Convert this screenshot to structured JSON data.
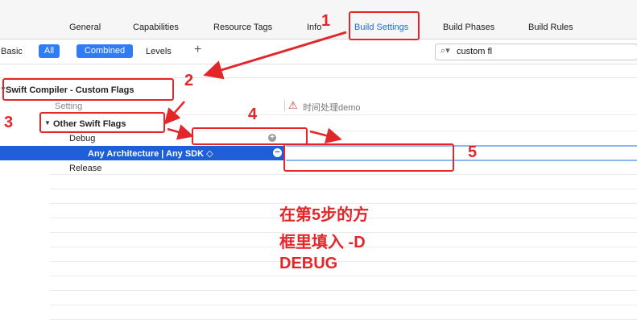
{
  "tabs": [
    {
      "label": "General",
      "active": false
    },
    {
      "label": "Capabilities",
      "active": false
    },
    {
      "label": "Resource Tags",
      "active": false
    },
    {
      "label": "Info",
      "active": false
    },
    {
      "label": "Build Settings",
      "active": true
    },
    {
      "label": "Build Phases",
      "active": false
    },
    {
      "label": "Build Rules",
      "active": false
    }
  ],
  "scope": {
    "basic": "Basic",
    "all": "All",
    "combined": "Combined",
    "levels": "Levels",
    "add": "+"
  },
  "search": {
    "value": "custom fl",
    "icon": "search-icon"
  },
  "section": {
    "title": "Swift Compiler - Custom Flags",
    "setting_header": "Setting",
    "target_header": "时间处理demo",
    "group": "Other Swift Flags",
    "debug": "Debug",
    "selected": "Any Architecture | Any SDK ◇",
    "release": "Release"
  },
  "annotations": {
    "n1": "1",
    "n2": "2",
    "n3": "3",
    "n4": "4",
    "n5": "5",
    "note_line1": "在第5步的方",
    "note_line2": "框里填入 -D",
    "note_line3": "DEBUG"
  },
  "colors": {
    "accent": "#1a6fe0",
    "selection": "#1e5fd8",
    "annotation": "#e3262a"
  }
}
